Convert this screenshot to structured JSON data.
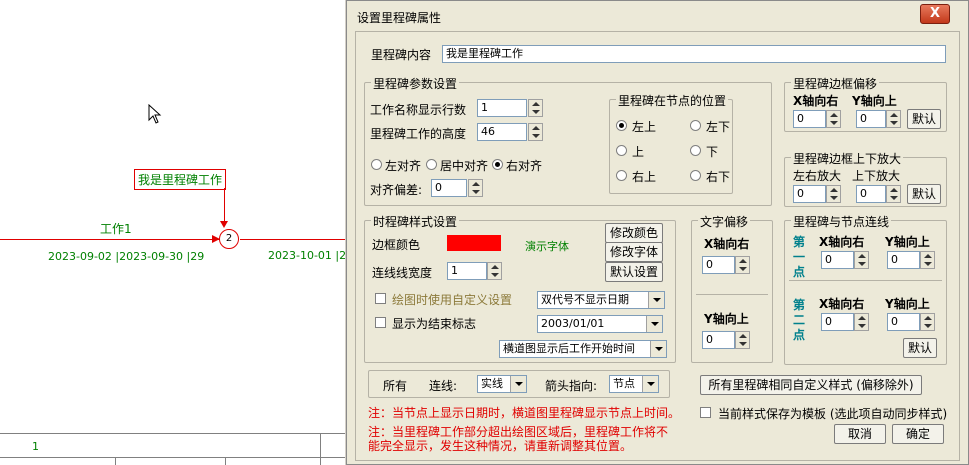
{
  "canvas": {
    "task_label": "工作1",
    "node_number": "2",
    "milestone_label": "我是里程碑工作",
    "date_left": "2023-09-02 |2023-09-30 |29",
    "date_right": "2023-10-01 |20",
    "row_number": "1"
  },
  "dialog": {
    "title": "设置里程碑属性",
    "close_symbol": "X",
    "content_label": "里程碑内容",
    "content_value": "我是里程碑工作",
    "params": {
      "title": "里程碑参数设置",
      "rows_label": "工作名称显示行数",
      "rows_value": "1",
      "height_label": "里程碑工作的高度",
      "height_value": "46",
      "align_left": "左对齐",
      "align_center": "居中对齐",
      "align_right": "右对齐",
      "offset_label": "对齐偏差:",
      "offset_value": "0",
      "position": {
        "title": "里程碑在节点的位置",
        "top_left": "左上",
        "bottom_left": "左下",
        "top": "上",
        "bottom": "下",
        "top_right": "右上",
        "bottom_right": "右下"
      }
    },
    "border_offset": {
      "title": "里程碑边框偏移",
      "x_label": "X轴向右",
      "y_label": "Y轴向上",
      "x_value": "0",
      "y_value": "0",
      "default_button": "默认"
    },
    "border_scale": {
      "title": "里程碑边框上下放大",
      "lr_label": "左右放大",
      "ud_label": "上下放大",
      "lr_value": "0",
      "ud_value": "0",
      "default_button": "默认"
    },
    "style": {
      "title": "时程碑样式设置",
      "border_color_label": "边框颜色",
      "border_color": "#ff0000",
      "demo_font": "演示字体",
      "modify_color_button": "修改颜色",
      "modify_font_button": "修改字体",
      "default_settings_button": "默认设置",
      "line_width_label": "连线线宽度",
      "line_width_value": "1",
      "custom_settings_label": "绘图时使用自定义设置",
      "show_end_label": "显示为结束标志",
      "date_mode_select": "双代号不显示日期",
      "date_select": "2003/01/01",
      "bar_chart_select": "横道图显示后工作开始时间"
    },
    "text_offset": {
      "title": "文字偏移",
      "x_label": "X轴向右",
      "x_value": "0",
      "y_label": "Y轴向上",
      "y_value": "0"
    },
    "node_link": {
      "title": "里程碑与节点连线",
      "point1_label": "第一点",
      "point2_label": "第二点",
      "x_label": "X轴向右",
      "y_label": "Y轴向上",
      "p1x": "0",
      "p1y": "0",
      "p2x": "0",
      "p2y": "0",
      "default_button": "默认"
    },
    "bottom_bar": {
      "all_label": "所有",
      "line_label": "连线:",
      "line_value": "实线",
      "arrow_label": "箭头指向:",
      "arrow_value": "节点"
    },
    "same_style_button": "所有里程碑相同自定义样式 (偏移除外)",
    "note1": "注：当节点上显示日期时，横道图里程碑显示节点上时间。",
    "note2_line1": "注：当里程碑工作部分超出绘图区域后，里程碑工作将不",
    "note2_line2": "能完全显示，发生这种情况，请重新调整其位置。",
    "save_template_label": "当前样式保存为模板 (选此项自动同步样式)",
    "cancel_button": "取消",
    "ok_button": "确定"
  }
}
